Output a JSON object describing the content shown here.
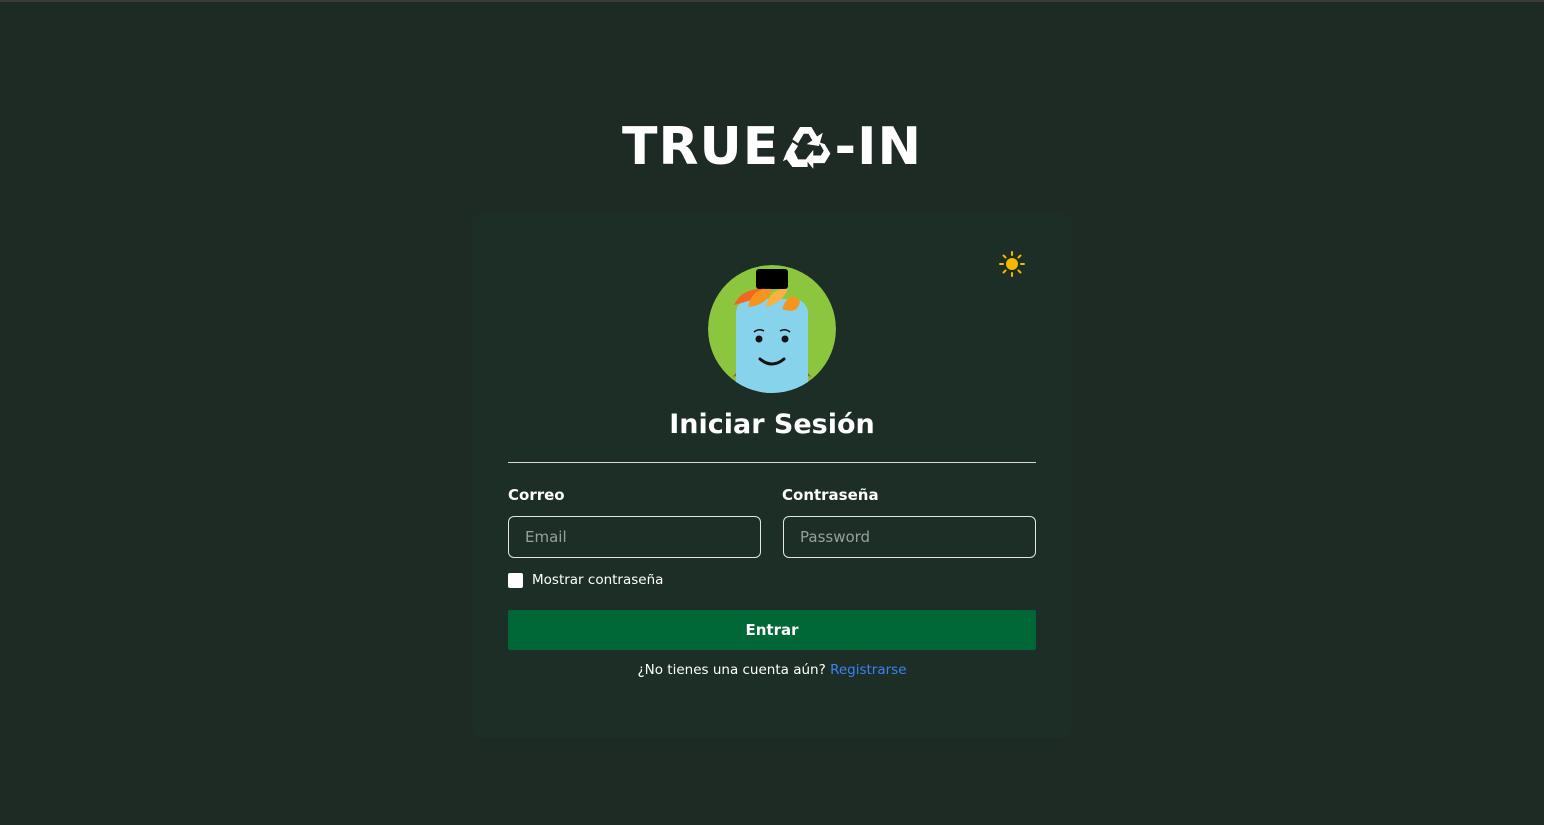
{
  "logo": {
    "text_left": "TRUE",
    "text_right": "-IN",
    "icon": "recycle-icon"
  },
  "theme_toggle": {
    "icon": "sun-icon",
    "color": "#f5b800"
  },
  "avatar": {
    "icon": "bottle-mascot-avatar"
  },
  "login": {
    "title": "Iniciar Sesión",
    "email_label": "Correo",
    "email_placeholder": "Email",
    "password_label": "Contraseña",
    "password_placeholder": "Password",
    "show_password_label": "Mostrar contraseña",
    "submit_label": "Entrar",
    "signup_prompt": "¿No tienes una cuenta aún? ",
    "signup_link": "Registrarse"
  },
  "colors": {
    "background": "#1e2b24",
    "card": "#1c2e25",
    "primary_button": "#006837",
    "link": "#3b82f6"
  }
}
